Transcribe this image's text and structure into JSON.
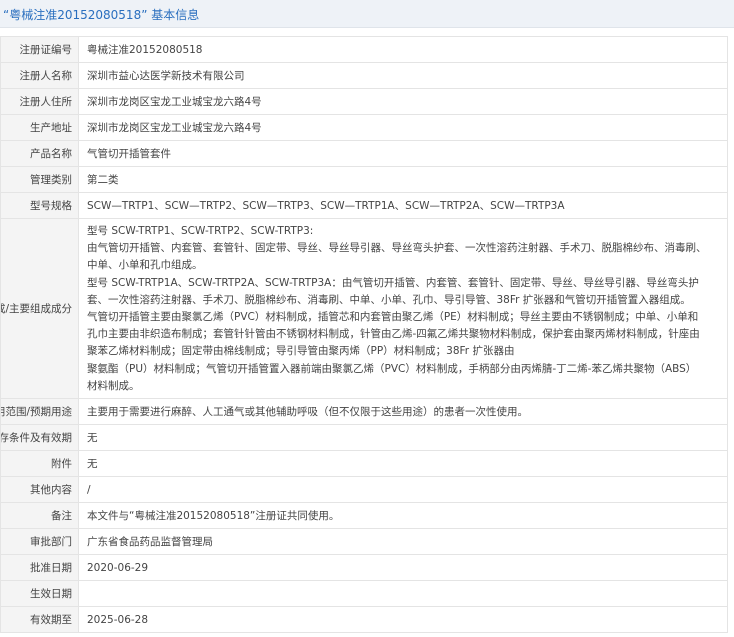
{
  "header": {
    "title": "“粤械注准20152080518” 基本信息"
  },
  "rows": [
    {
      "label": "注册证编号",
      "value": "粤械注准20152080518"
    },
    {
      "label": "注册人名称",
      "value": "深圳市益心达医学新技术有限公司"
    },
    {
      "label": "注册人住所",
      "value": "深圳市龙岗区宝龙工业城宝龙六路4号"
    },
    {
      "label": "生产地址",
      "value": "深圳市龙岗区宝龙工业城宝龙六路4号"
    },
    {
      "label": "产品名称",
      "value": "气管切开插管套件"
    },
    {
      "label": "管理类别",
      "value": "第二类"
    },
    {
      "label": "型号规格",
      "value": "SCW—TRTP1、SCW—TRTP2、SCW—TRTP3、SCW—TRTP1A、SCW—TRTP2A、SCW—TRTP3A"
    }
  ],
  "composition": {
    "label": "结构及组成/主要组成成分",
    "lines": [
      "型号 SCW-TRTP1、SCW-TRTP2、SCW-TRTP3:",
      "由气管切开插管、内套管、套管针、固定带、导丝、导丝导引器、导丝弯头护套、一次性溶药注射器、手术刀、脱脂棉纱布、消毒刷、",
      "中单、小单和孔巾组成。",
      "型号 SCW-TRTP1A、SCW-TRTP2A、SCW-TRTP3A：由气管切开插管、内套管、套管针、固定带、导丝、导丝导引器、导丝弯头护",
      "套、一次性溶药注射器、手术刀、脱脂棉纱布、消毒刷、中单、小单、孔巾、导引导管、38Fr 扩张器和气管切开插管置入器组成。",
      "气管切开插管主要由聚氯乙烯（PVC）材料制成，插管芯和内套管由聚乙烯（PE）材料制成；导丝主要由不锈钢制成；中单、小单和",
      "孔巾主要由非织造布制成；套管针针管由不锈钢材料制成，针管由乙烯-四氟乙烯共聚物材料制成，保护套由聚丙烯材料制成，针座由",
      "聚苯乙烯材料制成；固定带由棉线制成；导引导管由聚丙烯（PP）材料制成；38Fr 扩张器由",
      "聚氨酯（PU）材料制成；气管切开插管置入器前端由聚氯乙烯（PVC）材料制成，手柄部分由丙烯腈-丁二烯-苯乙烯共聚物（ABS）",
      "材料制成。"
    ]
  },
  "rows2": [
    {
      "label": "适用范围/预期用途",
      "value": "主要用于需要进行麻醉、人工通气或其他辅助呼吸（但不仅限于这些用途）的患者一次性使用。"
    },
    {
      "label": "产品储存条件及有效期",
      "value": "无"
    },
    {
      "label": "附件",
      "value": "无"
    },
    {
      "label": "其他内容",
      "value": "/"
    },
    {
      "label": "备注",
      "value": "本文件与“粤械注准20152080518”注册证共同使用。"
    },
    {
      "label": "审批部门",
      "value": "广东省食品药品监督管理局"
    },
    {
      "label": "批准日期",
      "value": "2020-06-29"
    },
    {
      "label": "生效日期",
      "value": ""
    },
    {
      "label": "有效期至",
      "value": "2025-06-28"
    }
  ]
}
